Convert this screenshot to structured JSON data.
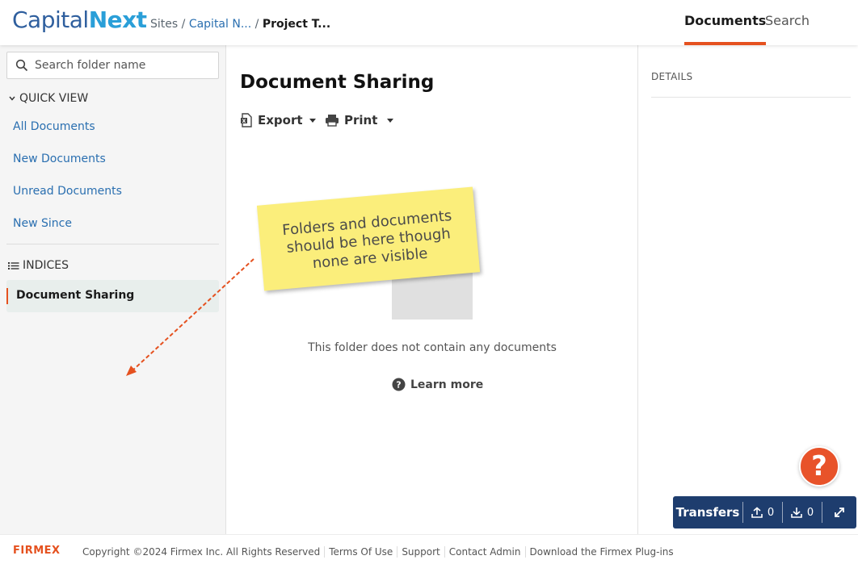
{
  "header": {
    "logo_part1": "Capital",
    "logo_part2": "Next",
    "breadcrumb": {
      "root": "Sites",
      "sep": "/",
      "link": "Capital N...",
      "current": "Project T..."
    },
    "tabs": {
      "documents": "Documents",
      "search": "Search"
    }
  },
  "sidebar": {
    "search_placeholder": "Search folder name",
    "quick_view_label": "QUICK VIEW",
    "quick_view_items": [
      "All Documents",
      "New Documents",
      "Unread Documents",
      "New Since"
    ],
    "indices_label": "INDICES",
    "active_item": "Document Sharing"
  },
  "main": {
    "title": "Document Sharing",
    "export_label": "Export",
    "print_label": "Print",
    "empty_text": "This folder does not contain any documents",
    "learn_more": "Learn more"
  },
  "details": {
    "label": "DETAILS"
  },
  "annotation": {
    "line1": "Folders and documents",
    "line2": "should be here though",
    "line3": "none are visible"
  },
  "help": {
    "glyph": "?"
  },
  "transfers": {
    "label": "Transfers",
    "uploads": "0",
    "downloads": "0"
  },
  "footer": {
    "brand": "FIRMEX",
    "copyright": "Copyright ©2024 Firmex Inc. All Rights Reserved",
    "links": [
      "Terms Of Use",
      "Support",
      "Contact Admin",
      "Download the Firmex Plug-ins"
    ]
  },
  "colors": {
    "accent_orange": "#e5511f",
    "brand_blue": "#2f5f9e",
    "brand_light_blue": "#2a9fd8",
    "link_blue": "#2a6fb0",
    "transfers_bg": "#1e3d6e",
    "note_yellow": "#fbee7b"
  }
}
